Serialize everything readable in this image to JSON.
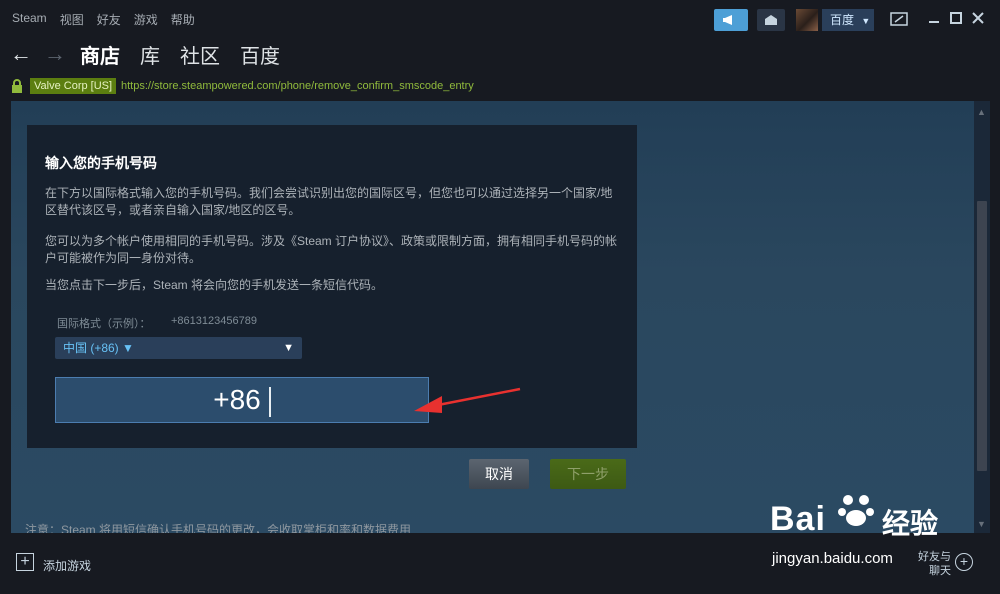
{
  "menu": [
    "Steam",
    "视图",
    "好友",
    "游戏",
    "帮助"
  ],
  "account": {
    "name": "百度"
  },
  "nav": {
    "links": [
      "商店",
      "库",
      "社区",
      "百度"
    ],
    "active": "商店"
  },
  "urlbar": {
    "cert": "Valve Corp [US]",
    "url": "https://store.steampowered.com/phone/remove_confirm_smscode_entry"
  },
  "panel": {
    "title": "输入您的手机号码",
    "para1": "在下方以国际格式输入您的手机号码。我们会尝试识别出您的国际区号，但您也可以通过选择另一个国家/地区替代该区号，或者亲自输入国家/地区的区号。",
    "para2": "您可以为多个帐户使用相同的手机号码。涉及《Steam 订户协议》、政策或限制方面，拥有相同手机号码的帐户可能被作为同一身份对待。",
    "para3": "当您点击下一步后，Steam 将会向您的手机发送一条短信代码。",
    "format_label": "国际格式（示例）：",
    "format_example": "+8613123456789",
    "country_select": "中国 (+86) ▼",
    "phone_value": "+86"
  },
  "buttons": {
    "cancel": "取消",
    "next": "下一步"
  },
  "notice": "注意：Steam 将用短信确认手机号码的更改，会收取掌柜和率和数据费用",
  "bottom": {
    "add_game": "添加游戏",
    "friends_line1": "好友与",
    "friends_line2": "聊天"
  },
  "watermark": {
    "brand": "Bai",
    "brand2": "经验",
    "url": "jingyan.baidu.com"
  },
  "colors": {
    "accent": "#4d9fd6",
    "page_bg": "#2a475e",
    "panel_bg": "#16202d",
    "url_green": "#90ba3c",
    "arrow_red": "#e8312f"
  }
}
